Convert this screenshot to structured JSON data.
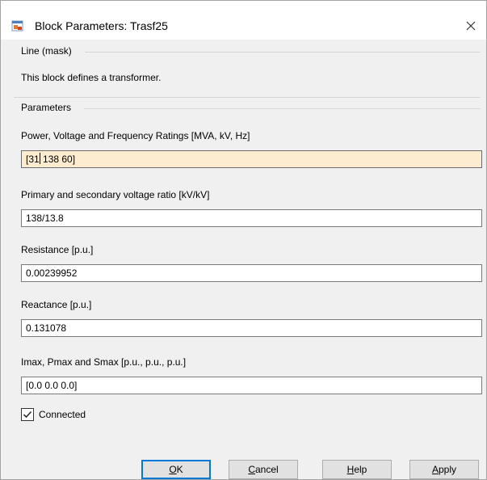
{
  "window": {
    "title": "Block Parameters: Trasf25",
    "icon": "simulink-block-icon",
    "close_icon": "close-icon"
  },
  "mask": {
    "header": "Line (mask)",
    "description": "This block defines a transformer."
  },
  "parameters": {
    "header": "Parameters",
    "fields": [
      {
        "label": "Power, Voltage and Frequency Ratings [MVA, kV, Hz]",
        "value_before_caret": "[31",
        "value_after_caret": " 138  60]",
        "focused": true
      },
      {
        "label": "Primary and secondary voltage ratio [kV/kV]",
        "value": "138/13.8"
      },
      {
        "label": "Resistance [p.u.]",
        "value": "0.00239952"
      },
      {
        "label": "Reactance [p.u.]",
        "value": "0.131078"
      },
      {
        "label": "Imax, Pmax and Smax [p.u., p.u., p.u.]",
        "value": "[0.0  0.0  0.0]"
      }
    ],
    "connected": {
      "label": "Connected",
      "checked": true
    }
  },
  "buttons": {
    "ok": {
      "mnemonic": "O",
      "rest": "K"
    },
    "cancel": {
      "mnemonic": "C",
      "rest": "ancel"
    },
    "help": {
      "mnemonic": "H",
      "rest": "elp"
    },
    "apply": {
      "mnemonic": "A",
      "rest": "pply"
    }
  },
  "colors": {
    "focused_field_bg": "#fdeccf",
    "default_button_border": "#0078d7",
    "button_bg": "#e1e1e1"
  }
}
